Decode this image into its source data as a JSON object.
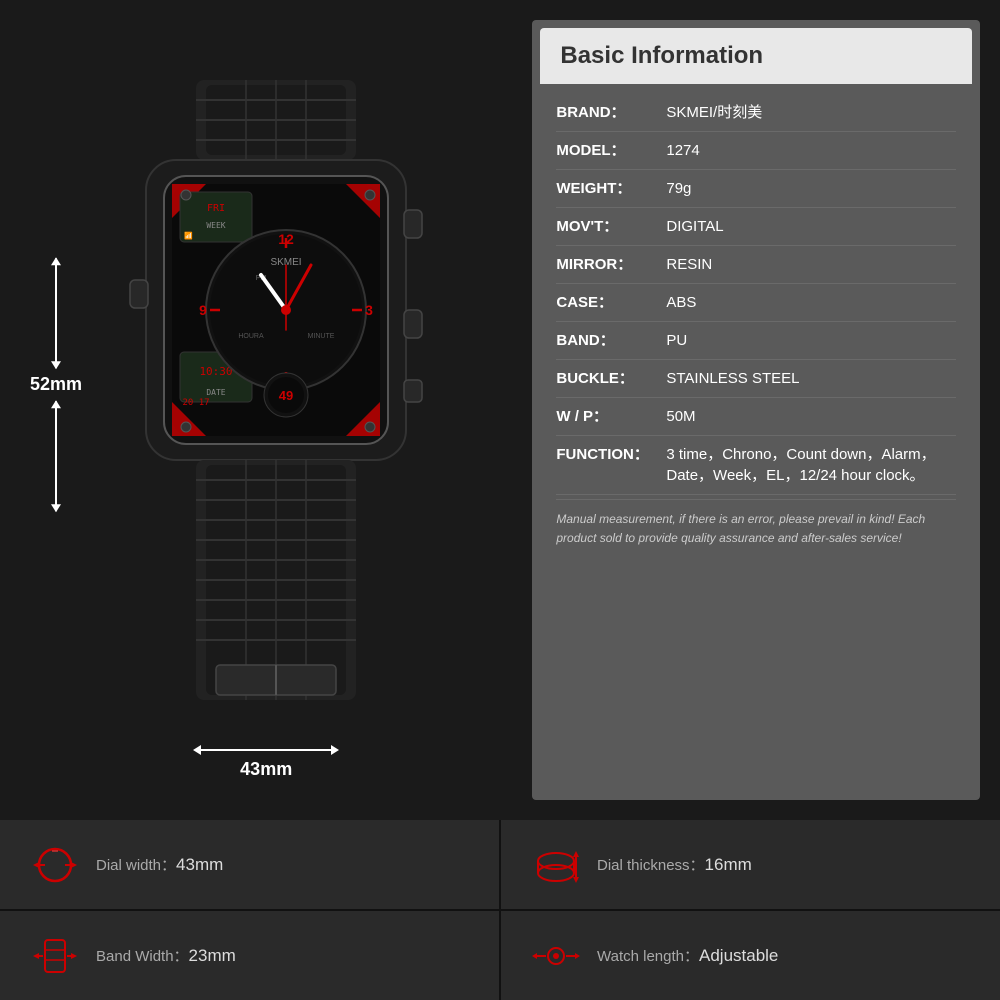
{
  "header": {
    "title": "Basic Information"
  },
  "specs": {
    "brand_label": "BRAND：",
    "brand_value": "SKMEI/时刻美",
    "model_label": "MODEL：",
    "model_value": "1274",
    "weight_label": "WEIGHT：",
    "weight_value": "79g",
    "movt_label": "MOV'T：",
    "movt_value": "DIGITAL",
    "mirror_label": "MIRROR：",
    "mirror_value": "RESIN",
    "case_label": "CASE：",
    "case_value": "ABS",
    "band_label": "BAND：",
    "band_value": "PU",
    "buckle_label": "BUCKLE：",
    "buckle_value": "STAINLESS STEEL",
    "wp_label": "W / P：",
    "wp_value": "50M",
    "function_label": "FUNCTION：",
    "function_value": "3 time，Chrono，Count down，Alarm，Date，Week，EL，12/24 hour clock。",
    "note": "Manual measurement, if there is an error, please prevail in kind!\nEach product sold to provide quality assurance and after-sales service!"
  },
  "dimensions": {
    "vertical": "52mm",
    "horizontal": "43mm"
  },
  "bottom_specs": [
    {
      "icon": "dial-width-icon",
      "label": "Dial width：",
      "value": "43mm"
    },
    {
      "icon": "dial-thickness-icon",
      "label": "Dial thickness：",
      "value": "16mm"
    },
    {
      "icon": "band-width-icon",
      "label": "Band Width：",
      "value": "23mm"
    },
    {
      "icon": "watch-length-icon",
      "label": "Watch length：",
      "value": "Adjustable"
    }
  ]
}
